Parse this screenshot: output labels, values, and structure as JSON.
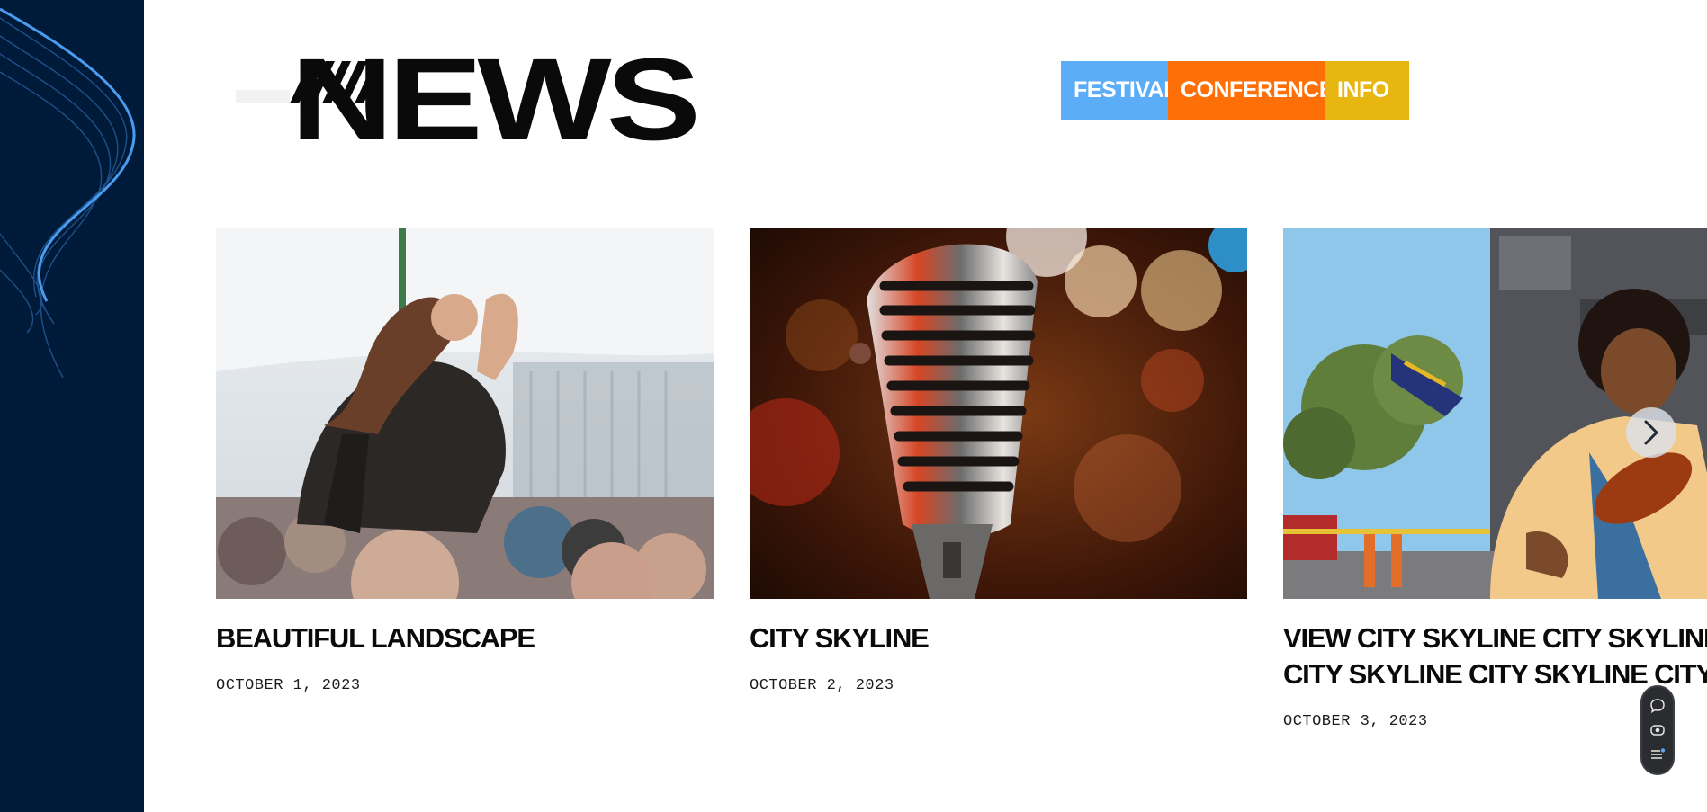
{
  "page": {
    "title": "NEWS"
  },
  "filters": [
    {
      "label": "FESTIVAL",
      "color": "#5aadf6"
    },
    {
      "label": "CONFERENCE",
      "color": "#ff6f08"
    },
    {
      "label": "INFO",
      "color": "#e7b611"
    }
  ],
  "cards": [
    {
      "title": "BEAUTIFUL LANDSCAPE",
      "date": "OCTOBER 1, 2023",
      "image": "festival-crowd-photo"
    },
    {
      "title": "CITY SKYLINE",
      "date": "OCTOBER 2, 2023",
      "image": "vintage-microphone-photo"
    },
    {
      "title_line1": "VIEW CITY SKYLINE CITY SKYLINE",
      "title_line2": "CITY SKYLINE CITY SKYLINE CITY",
      "date": "OCTOBER 3, 2023",
      "image": "street-violinist-photo"
    }
  ],
  "carousel": {
    "next_icon": "chevron-right-icon"
  },
  "floating_toolbar": {
    "icons": [
      "chat-icon",
      "eye-icon",
      "list-settings-icon"
    ]
  },
  "colors": {
    "sidebar": "#001a3a",
    "accent_line": "#3b86d8",
    "text": "#0a0a0a"
  }
}
